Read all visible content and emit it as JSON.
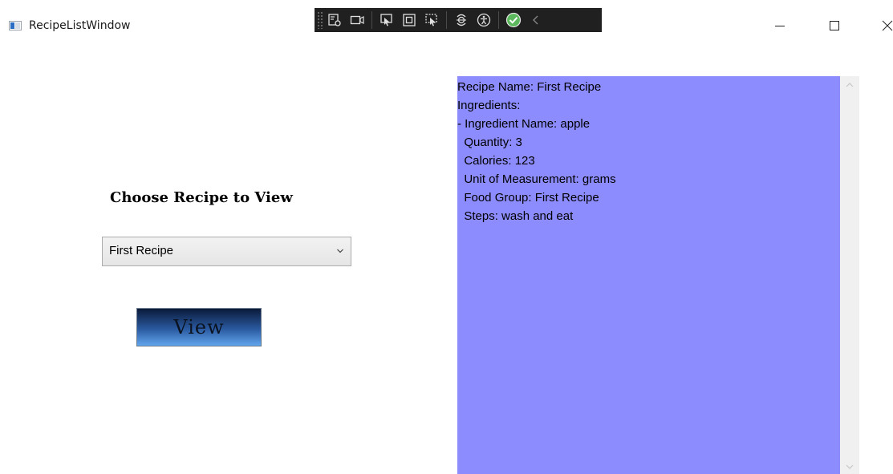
{
  "window": {
    "title": "RecipeListWindow",
    "icon": "app-window-icon",
    "caption_buttons": [
      "minimize-icon",
      "maximize-icon",
      "close-icon"
    ]
  },
  "debug_toolbar": {
    "icons": [
      "select-element-icon",
      "record-icon",
      "pick-element-icon",
      "display-layout-icon",
      "track-focus-icon",
      "hot-reload-icon",
      "accessibility-icon",
      "check-icon",
      "collapse-chevron-icon"
    ]
  },
  "main": {
    "heading": "Choose Recipe to View",
    "recipe_select": {
      "selected": "First Recipe"
    },
    "view_button": "View"
  },
  "details": {
    "lines": [
      "Recipe Name: First Recipe",
      "Ingredients:",
      "- Ingredient Name: apple",
      "  Quantity: 3",
      "  Calories: 123",
      "  Unit of Measurement: grams",
      "  Food Group: First Recipe",
      "  Steps: wash and eat"
    ]
  },
  "colors": {
    "details_background": "#8c8cff",
    "toolbar_background": "#202020",
    "check_green": "#5cb85c"
  }
}
